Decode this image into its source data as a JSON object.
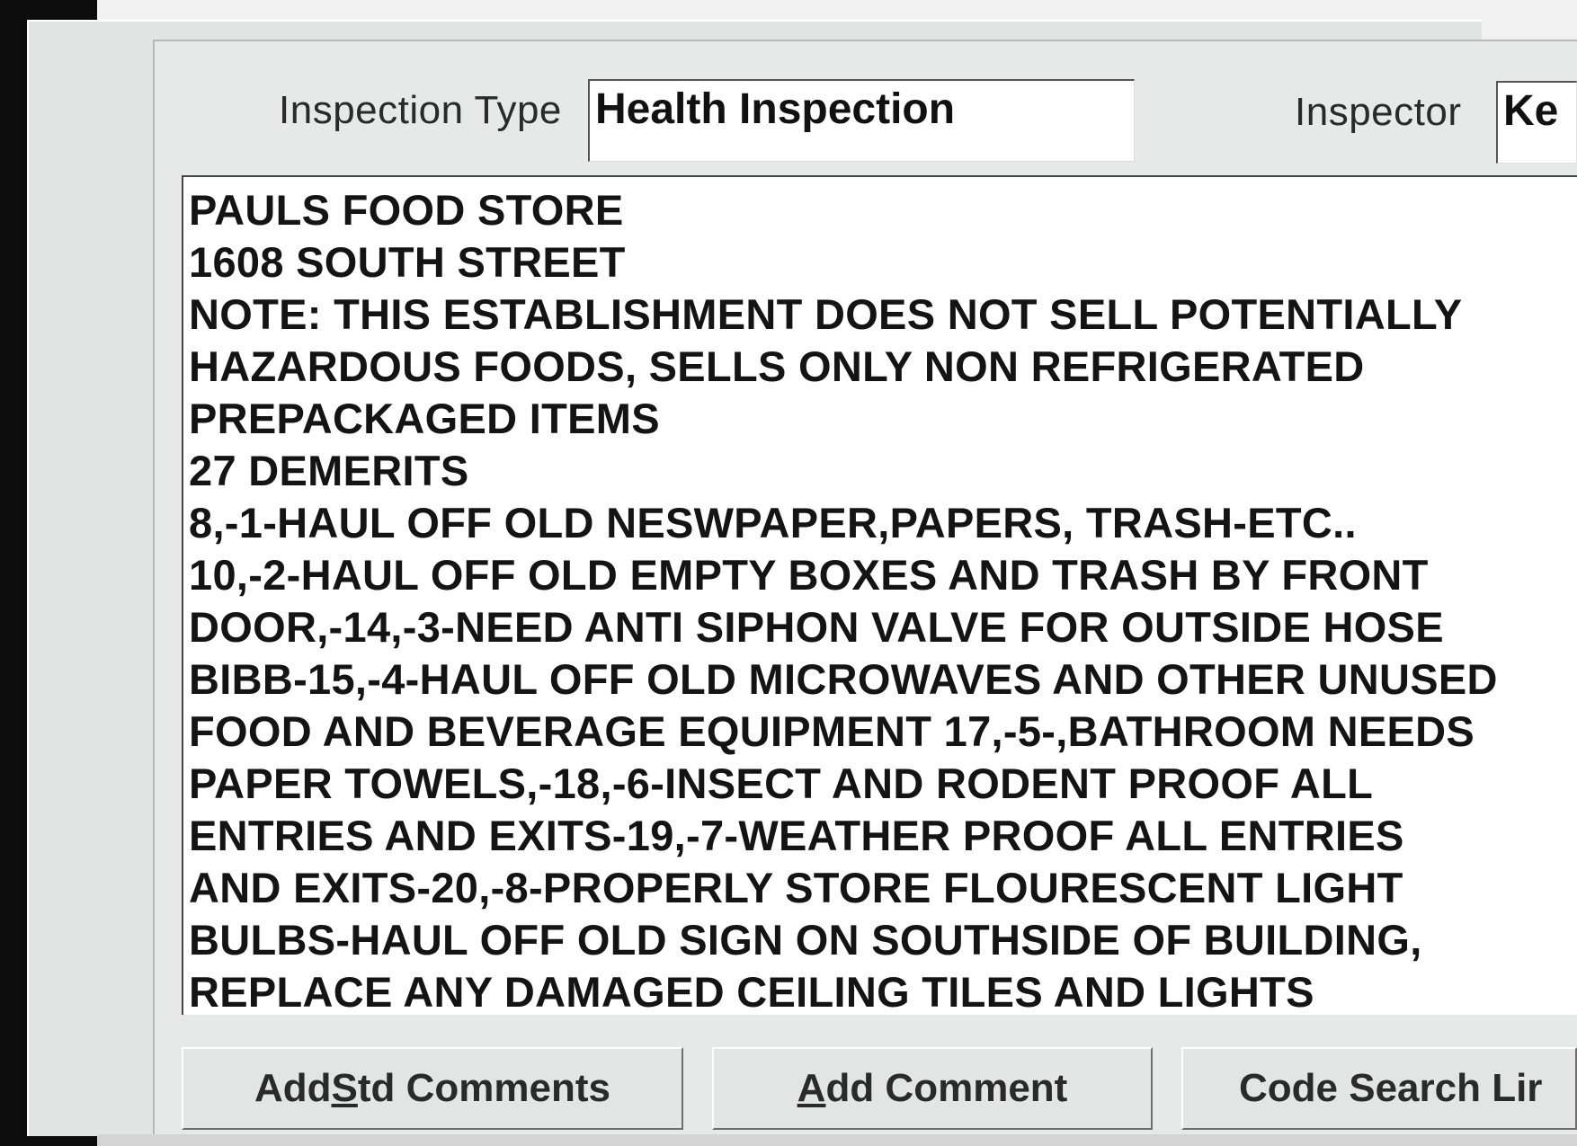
{
  "form": {
    "inspection_type_label": "Inspection Type",
    "inspection_type_value": "Health Inspection",
    "inspector_label": "Inspector",
    "inspector_value": "Ke"
  },
  "comments": {
    "lines": [
      "PAULS FOOD STORE",
      "1608 SOUTH STREET",
      "NOTE: THIS ESTABLISHMENT DOES NOT SELL POTENTIALLY",
      "HAZARDOUS FOODS, SELLS ONLY NON REFRIGERATED",
      "PREPACKAGED ITEMS",
      "27 DEMERITS",
      "8,-1-HAUL OFF OLD NESWPAPER,PAPERS, TRASH-ETC..",
      "10,-2-HAUL OFF OLD EMPTY BOXES AND TRASH BY FRONT",
      "DOOR,-14,-3-NEED ANTI SIPHON VALVE FOR OUTSIDE HOSE",
      "BIBB-15,-4-HAUL OFF OLD MICROWAVES AND OTHER UNUSED",
      "FOOD AND BEVERAGE EQUIPMENT 17,-5-,BATHROOM NEEDS",
      "PAPER TOWELS,-18,-6-INSECT AND RODENT PROOF ALL",
      "ENTRIES AND EXITS-19,-7-WEATHER PROOF ALL ENTRIES",
      "AND EXITS-20,-8-PROPERLY STORE FLOURESCENT LIGHT",
      "BULBS-HAUL OFF OLD SIGN ON SOUTHSIDE OF BUILDING,",
      "REPLACE ANY DAMAGED CEILING TILES AND LIGHTS"
    ]
  },
  "buttons": {
    "std_comments_pre": "Add ",
    "std_comments_mn": "S",
    "std_comments_post": "td Comments",
    "add_comment_mn": "A",
    "add_comment_post": "dd Comment",
    "code_search": "Code Search Lir"
  }
}
